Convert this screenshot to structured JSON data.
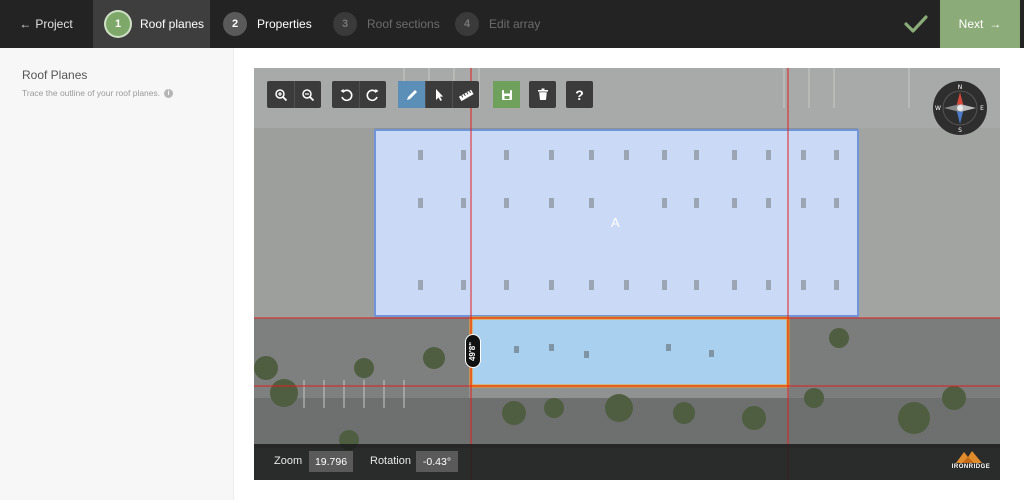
{
  "topbar": {
    "back_label": "Project",
    "steps": [
      {
        "num": "1",
        "label": "Roof planes"
      },
      {
        "num": "2",
        "label": "Properties"
      },
      {
        "num": "3",
        "label": "Roof sections"
      },
      {
        "num": "4",
        "label": "Edit array"
      }
    ],
    "next_label": "Next"
  },
  "sidebar": {
    "title": "Roof Planes",
    "hint": "Trace the outline of your roof planes."
  },
  "map": {
    "toolbar_icons": [
      "zoom-in-icon",
      "zoom-out-icon",
      "undo-icon",
      "redo-icon",
      "pencil-icon",
      "pointer-icon",
      "ruler-icon",
      "save-icon",
      "trash-icon",
      "help-icon"
    ],
    "plane_label": "A",
    "dimension": "49'8\"",
    "zoom_label": "Zoom",
    "zoom_value": "19.796",
    "rotation_label": "Rotation",
    "rotation_value": "-0.43°",
    "brand": "IRONRIDGE",
    "compass": {
      "n": "N",
      "s": "S",
      "e": "E",
      "w": "W"
    }
  },
  "colors": {
    "accent_green": "#8bab78",
    "selected_plane": "#c9d9f6",
    "secondary_plane": "#a9d0ee",
    "plane_outline_orange": "#f0a020",
    "guide_red": "#e02020"
  }
}
